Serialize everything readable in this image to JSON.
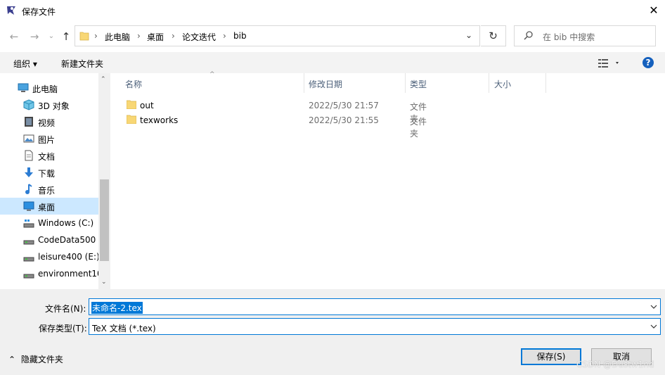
{
  "window": {
    "title": "保存文件",
    "close_icon": "✕"
  },
  "nav": {
    "back": "←",
    "forward": "→",
    "up": "↑"
  },
  "breadcrumb": [
    "此电脑",
    "桌面",
    "论文迭代",
    "bib"
  ],
  "search": {
    "placeholder": "在 bib 中搜索"
  },
  "toolbar": {
    "organize": "组织 ▾",
    "new_folder": "新建文件夹",
    "view_icon": "details-view-icon",
    "help": "?"
  },
  "sidebar": {
    "items": [
      {
        "label": "此电脑",
        "icon": "computer-icon"
      },
      {
        "label": "3D 对象",
        "icon": "cube-icon"
      },
      {
        "label": "视频",
        "icon": "video-icon"
      },
      {
        "label": "图片",
        "icon": "image-icon"
      },
      {
        "label": "文档",
        "icon": "document-icon"
      },
      {
        "label": "下载",
        "icon": "download-icon"
      },
      {
        "label": "音乐",
        "icon": "music-icon"
      },
      {
        "label": "桌面",
        "icon": "desktop-icon"
      },
      {
        "label": "Windows (C:)",
        "icon": "drive-icon"
      },
      {
        "label": "CodeData500 (",
        "icon": "drive-icon"
      },
      {
        "label": "leisure400 (E:)",
        "icon": "drive-icon"
      },
      {
        "label": "environment10",
        "icon": "drive-icon"
      }
    ]
  },
  "columns": {
    "name": "名称",
    "date": "修改日期",
    "type": "类型",
    "size": "大小"
  },
  "files": [
    {
      "name": "out",
      "date": "2022/5/30 21:57",
      "type": "文件夹"
    },
    {
      "name": "texworks",
      "date": "2022/5/30 21:55",
      "type": "文件夹"
    }
  ],
  "bottom": {
    "filename_label": "文件名(N):",
    "filename_value": "未命名-2.tex",
    "filetype_label": "保存类型(T):",
    "filetype_value": "TeX 文档 (*.tex)",
    "hide_folders": "隐藏文件夹",
    "save": "保存(S)",
    "cancel": "取消"
  },
  "watermark": "CSDN @Dustw1nd",
  "colors": {
    "accent": "#0078d7",
    "selection": "#cce8ff",
    "folder": "#f8d775"
  }
}
